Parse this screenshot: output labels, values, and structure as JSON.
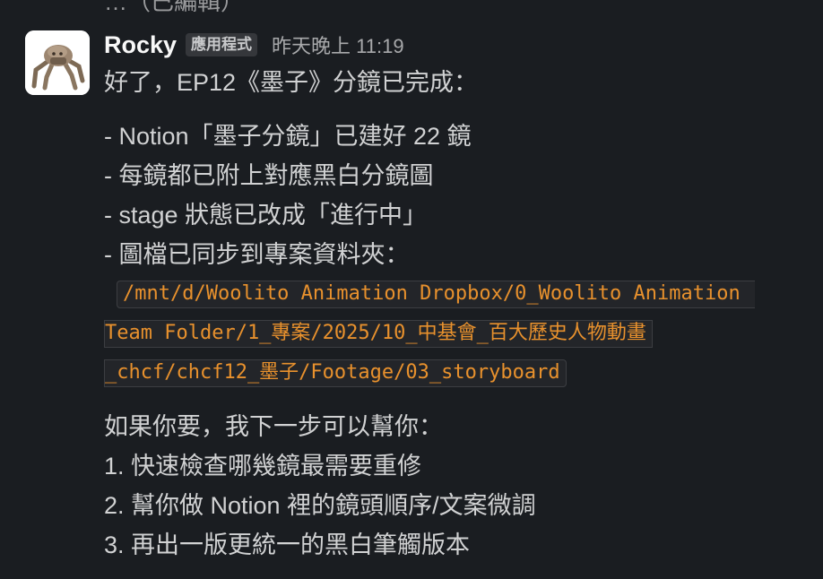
{
  "previous_message_fragment": "…（已編輯）",
  "message": {
    "author": "Rocky",
    "badge": "應用程式",
    "timestamp": "昨天晚上 11:19",
    "intro": "好了，EP12《墨子》分鏡已完成：",
    "bullets": [
      "- Notion「墨子分鏡」已建好 22 鏡",
      "- 每鏡都已附上對應黑白分鏡圖",
      "- stage 狀態已改成「進行中」",
      "- 圖檔已同步到專案資料夾："
    ],
    "code_path_lines": [
      "/mnt/d/Woolito Animation Dropbox/0_Woolito Animation",
      "Team Folder/1_專案/2025/10_中基會_百大歷史人物動畫",
      "_chcf/chcf12_墨子/Footage/03_storyboard"
    ],
    "followup_intro": "如果你要，我下一步可以幫你：",
    "options": [
      "1. 快速檢查哪幾鏡最需要重修",
      "2. 幫你做 Notion 裡的鏡頭順序/文案微調",
      "3. 再出一版更統一的黑白筆觸版本"
    ]
  },
  "colors": {
    "background": "#1a1d21",
    "text": "#d1d2d3",
    "username": "#f8f8f8",
    "code_text": "#e8912d",
    "badge_bg": "#35373b"
  },
  "icons": {
    "avatar": "robot-spider-avatar-icon"
  }
}
